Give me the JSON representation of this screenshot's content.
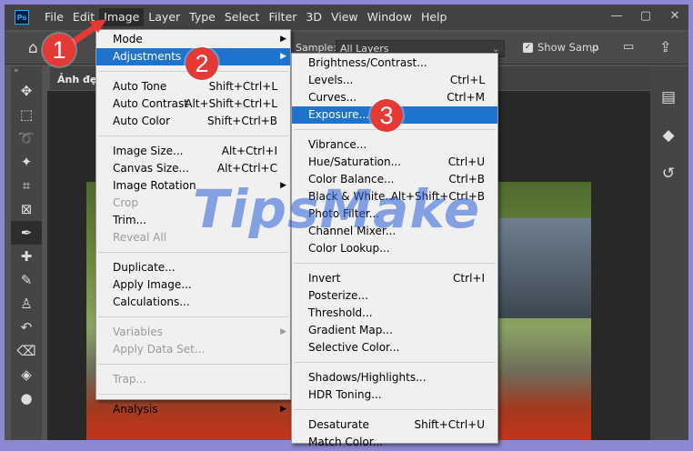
{
  "menubar": {
    "logo": "Ps",
    "items": [
      "File",
      "Edit",
      "Image",
      "Layer",
      "Type",
      "Select",
      "Filter",
      "3D",
      "View",
      "Window",
      "Help"
    ],
    "active": "Image"
  },
  "window_controls": {
    "minimize": "—",
    "maximize": "▢",
    "close": "✕"
  },
  "options": {
    "sample_label": "Sample:",
    "sample_value": "All Layers",
    "show_sampling": "Show Samp",
    "show_sampling_checked": true
  },
  "doc_tab": {
    "title": "Ảnh đẹp"
  },
  "watermark": "TipsMake",
  "image_menu": [
    {
      "label": "Mode",
      "submenu": true
    },
    {
      "label": "Adjustments",
      "submenu": true,
      "highlight": true
    },
    {
      "sep": true
    },
    {
      "label": "Auto Tone",
      "shortcut": "Shift+Ctrl+L"
    },
    {
      "label": "Auto Contrast",
      "shortcut": "Alt+Shift+Ctrl+L"
    },
    {
      "label": "Auto Color",
      "shortcut": "Shift+Ctrl+B"
    },
    {
      "sep": true
    },
    {
      "label": "Image Size...",
      "shortcut": "Alt+Ctrl+I"
    },
    {
      "label": "Canvas Size...",
      "shortcut": "Alt+Ctrl+C"
    },
    {
      "label": "Image Rotation",
      "submenu": true
    },
    {
      "label": "Crop",
      "disabled": true
    },
    {
      "label": "Trim..."
    },
    {
      "label": "Reveal All",
      "disabled": true
    },
    {
      "sep": true
    },
    {
      "label": "Duplicate..."
    },
    {
      "label": "Apply Image..."
    },
    {
      "label": "Calculations..."
    },
    {
      "sep": true
    },
    {
      "label": "Variables",
      "submenu": true,
      "disabled": true
    },
    {
      "label": "Apply Data Set...",
      "disabled": true
    },
    {
      "sep": true
    },
    {
      "label": "Trap...",
      "disabled": true
    },
    {
      "sep": true
    },
    {
      "label": "Analysis",
      "submenu": true
    }
  ],
  "adjustments_menu": [
    {
      "label": "Brightness/Contrast..."
    },
    {
      "label": "Levels...",
      "shortcut": "Ctrl+L"
    },
    {
      "label": "Curves...",
      "shortcut": "Ctrl+M"
    },
    {
      "label": "Exposure...",
      "highlight": true
    },
    {
      "sep": true
    },
    {
      "label": "Vibrance..."
    },
    {
      "label": "Hue/Saturation...",
      "shortcut": "Ctrl+U"
    },
    {
      "label": "Color Balance...",
      "shortcut": "Ctrl+B"
    },
    {
      "label": "Black & White...",
      "shortcut": "Alt+Shift+Ctrl+B"
    },
    {
      "label": "Photo Filter..."
    },
    {
      "label": "Channel Mixer..."
    },
    {
      "label": "Color Lookup..."
    },
    {
      "sep": true
    },
    {
      "label": "Invert",
      "shortcut": "Ctrl+I"
    },
    {
      "label": "Posterize..."
    },
    {
      "label": "Threshold..."
    },
    {
      "label": "Gradient Map..."
    },
    {
      "label": "Selective Color..."
    },
    {
      "sep": true
    },
    {
      "label": "Shadows/Highlights..."
    },
    {
      "label": "HDR Toning..."
    },
    {
      "sep": true
    },
    {
      "label": "Desaturate",
      "shortcut": "Shift+Ctrl+U"
    },
    {
      "label": "Match Color..."
    }
  ],
  "badges": [
    "1",
    "2",
    "3"
  ],
  "colors": {
    "highlight": "#1e73cf",
    "badge": "#e53935",
    "frame": "#8d88d3"
  }
}
